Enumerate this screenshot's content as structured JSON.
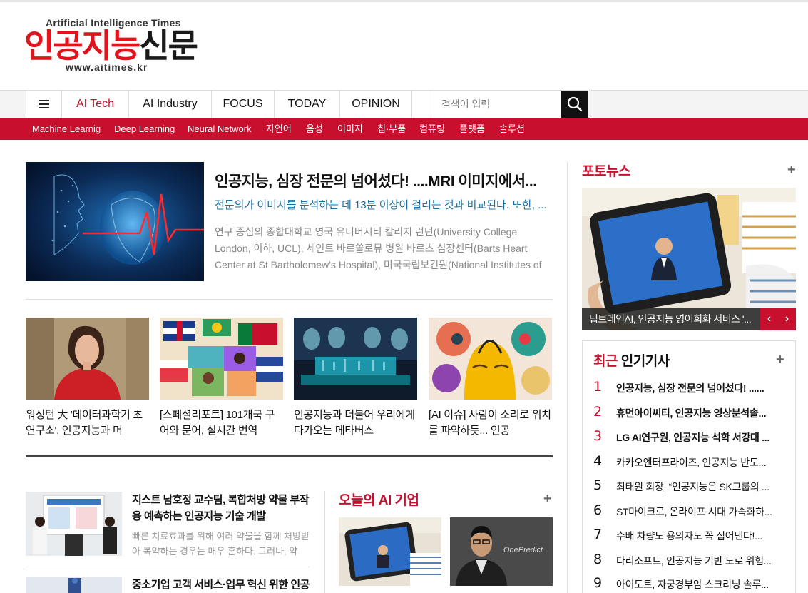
{
  "logo": {
    "english": "Artificial Intelligence Times",
    "korean_red": "인공지능",
    "korean_black": "신문",
    "url": "www.aitimes.kr"
  },
  "nav": {
    "items": [
      {
        "label": "AI Tech",
        "active": true
      },
      {
        "label": "AI Industry",
        "active": false
      },
      {
        "label": "FOCUS",
        "active": false
      },
      {
        "label": "TODAY",
        "active": false
      },
      {
        "label": "OPINION",
        "active": false
      }
    ],
    "search_placeholder": "검색어 입력"
  },
  "subnav": [
    "Machine Learnig",
    "Deep Learning",
    "Neural Network",
    "자연어",
    "음성",
    "이미지",
    "칩·부품",
    "컴퓨팅",
    "플랫폼",
    "솔루션"
  ],
  "lead": {
    "title": "인공지능, 심장 전문의 넘어섰다! ....MRI 이미지에서...",
    "subtitle": "전문의가 이미지를 분석하는 데 13분 이상이 걸리는 것과 비교된다. 또한, ...",
    "body": "연구 중심의 종합대학교 영국 유니버시티 칼리지 런던(University College London, 이하, UCL), 세인트 바르쏠로뮤 병원 바르츠 심장센터(Barts Heart Center at St Bartholomew's Hospital), 미국국립보건원(National Institutes of Health) 등 공..."
  },
  "grid": [
    {
      "title": "워싱턴 大 '데이터과학기 초연구소', 인공지능과 머"
    },
    {
      "title": "[스페셜리포트] 101개국 구어와 문어, 실시간 번역"
    },
    {
      "title": "인공지능과 더불어 우리에게 다가오는 메타버스"
    },
    {
      "title": "[AI 이슈] 사람이 소리로 위치를 파악하듯... 인공"
    }
  ],
  "list": [
    {
      "title": "지스트 남호정 교수팀, 복합처방 약물 부작용 예측하는 인공지능 기술 개발",
      "body": "빠른 치료효과를 위해 여러 약물을 함께 처방받아 복약하는 경우는 매우 흔하다. 그러나, 약"
    },
    {
      "title": "중소기업 고객 서비스·업무 혁신 위한 인공",
      "body": ""
    }
  ],
  "today": {
    "heading": "오늘의 AI 기업",
    "images": [
      {
        "caption": ""
      },
      {
        "caption": "OnePredict"
      }
    ]
  },
  "photo_news": {
    "heading": "포토뉴스",
    "caption": "딥브레인AI, 인공지능 영어회화 서비스 '..."
  },
  "popular": {
    "heading_red": "최근",
    "heading_black": " 인기기사",
    "items": [
      {
        "num": "1",
        "title": "인공지능, 심장 전문의 넘어섰다! ......"
      },
      {
        "num": "2",
        "title": "휴먼아이씨티, 인공지능 영상분석솔..."
      },
      {
        "num": "3",
        "title": "LG AI연구원, 인공지능 석학 서강대 ..."
      },
      {
        "num": "4",
        "title": "카카오엔터프라이즈, 인공지능 반도..."
      },
      {
        "num": "5",
        "title": "최태원 회장, “인공지능은 SK그룹의 ..."
      },
      {
        "num": "6",
        "title": "ST마이크로, 온라이프 시대 가속화하..."
      },
      {
        "num": "7",
        "title": "수배 차량도 용의자도 꼭 집어낸다!..."
      },
      {
        "num": "8",
        "title": "다리소프트, 인공지능 기반 도로 위험..."
      },
      {
        "num": "9",
        "title": "아이도트, 자궁경부암 스크리닝 솔루..."
      }
    ]
  },
  "colors": {
    "brand_red": "#c8102e",
    "logo_red": "#e1141e",
    "link_blue": "#1a6f9f"
  }
}
